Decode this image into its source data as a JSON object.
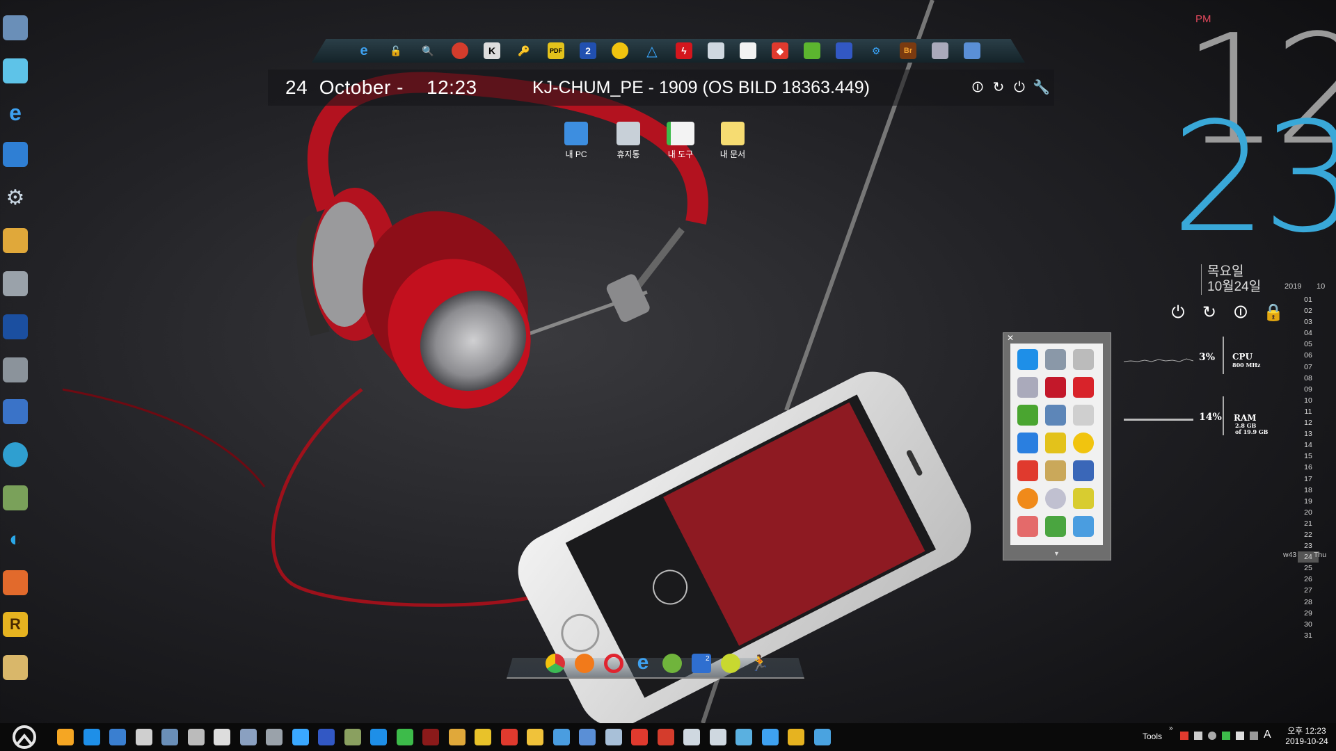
{
  "colors": {
    "accent_blue": "#39a8d8",
    "clock_hour": "#9a9a9a",
    "pm_red": "#e0485c",
    "taskbar": "#0a0a0a",
    "headphone_red": "#b3121f"
  },
  "left_desktop_icons": [
    {
      "name": "computer-icon"
    },
    {
      "name": "network-monitor-icon"
    },
    {
      "name": "internet-explorer-icon"
    },
    {
      "name": "cube-network-icon"
    },
    {
      "name": "gears-icon"
    },
    {
      "name": "paint-icon"
    },
    {
      "name": "drive-icon"
    },
    {
      "name": "display-settings-icon"
    },
    {
      "name": "usb-drive-icon"
    },
    {
      "name": "monitor-icon"
    },
    {
      "name": "shell-icon"
    },
    {
      "name": "download-icon"
    },
    {
      "name": "swirl-app-icon"
    },
    {
      "name": "windows-flag-icon"
    },
    {
      "name": "r-app-icon"
    },
    {
      "name": "folder-icon"
    }
  ],
  "top_dock_icons": [
    "internet-explorer-icon",
    "lock-icon",
    "search-icon",
    "chrome-icon",
    "k-app-icon",
    "key-icon",
    "pdf-icon",
    "number-two-icon",
    "disc-icon",
    "triangle-app-icon",
    "flash-icon",
    "clock-drive-icon",
    "mail-icon",
    "anydesk-icon",
    "green-drive-icon",
    "floppy-icon",
    "gear-cloud-icon",
    "bridge-icon",
    "usb-icon",
    "settings-network-icon"
  ],
  "info_bar": {
    "date_text": "24  October -    12:23",
    "host_text": "KJ-CHUM_PE - 1909 (OS BILD 18363.449)"
  },
  "desktop_shortcuts": [
    {
      "label": "내 PC",
      "icon": "pc-icon"
    },
    {
      "label": "휴지통",
      "icon": "recycle-bin-icon"
    },
    {
      "label": "내 도구",
      "icon": "tools-folder-icon"
    },
    {
      "label": "내 문서",
      "icon": "documents-folder-icon"
    }
  ],
  "big_clock": {
    "ampm": "PM",
    "hour": "12",
    "minute": "23",
    "weekday": "목요일",
    "month_day": "10월24일"
  },
  "calendar": {
    "year": "2019",
    "month": "10",
    "week": "w43",
    "weekday_short": "Thu",
    "today": "24",
    "days": [
      "01",
      "02",
      "03",
      "04",
      "05",
      "06",
      "07",
      "08",
      "09",
      "10",
      "11",
      "12",
      "13",
      "14",
      "15",
      "16",
      "17",
      "18",
      "19",
      "20",
      "21",
      "22",
      "23",
      "24",
      "25",
      "26",
      "27",
      "28",
      "29",
      "30",
      "31"
    ]
  },
  "meters": {
    "cpu_percent": "3%",
    "cpu_label": "CPU",
    "cpu_freq": "800 MHz",
    "ram_percent": "14%",
    "ram_label": "RAM",
    "ram_used": "2.8 GB",
    "ram_total": "of 19.9 GB"
  },
  "bottom_dock": {
    "badge": "2",
    "icons": [
      "chrome-icon",
      "firefox-icon",
      "opera-icon",
      "internet-explorer-icon",
      "utorrent-icon",
      "network-icon",
      "green-app-icon",
      "run-icon"
    ]
  },
  "taskbar": {
    "tools_label": "Tools",
    "overflow": "»",
    "ime": "A",
    "time": "오후 12:23",
    "date": "2019-10-24"
  }
}
